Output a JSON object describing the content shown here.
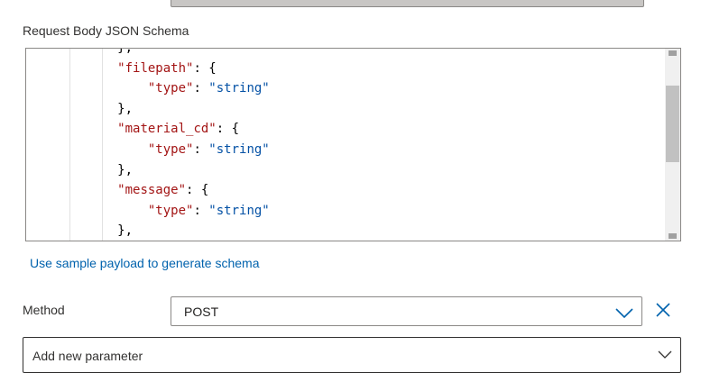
{
  "schema": {
    "label": "Request Body JSON Schema",
    "code_lines": [
      [
        {
          "t": "p",
          "v": "            },"
        }
      ],
      [
        {
          "t": "p",
          "v": "            "
        },
        {
          "t": "k",
          "v": "\"filepath\""
        },
        {
          "t": "p",
          "v": ": {"
        }
      ],
      [
        {
          "t": "p",
          "v": "                "
        },
        {
          "t": "k",
          "v": "\"type\""
        },
        {
          "t": "p",
          "v": ": "
        },
        {
          "t": "s",
          "v": "\"string\""
        }
      ],
      [
        {
          "t": "p",
          "v": "            },"
        }
      ],
      [
        {
          "t": "p",
          "v": "            "
        },
        {
          "t": "k",
          "v": "\"material_cd\""
        },
        {
          "t": "p",
          "v": ": {"
        }
      ],
      [
        {
          "t": "p",
          "v": "                "
        },
        {
          "t": "k",
          "v": "\"type\""
        },
        {
          "t": "p",
          "v": ": "
        },
        {
          "t": "s",
          "v": "\"string\""
        }
      ],
      [
        {
          "t": "p",
          "v": "            },"
        }
      ],
      [
        {
          "t": "p",
          "v": "            "
        },
        {
          "t": "k",
          "v": "\"message\""
        },
        {
          "t": "p",
          "v": ": {"
        }
      ],
      [
        {
          "t": "p",
          "v": "                "
        },
        {
          "t": "k",
          "v": "\"type\""
        },
        {
          "t": "p",
          "v": ": "
        },
        {
          "t": "s",
          "v": "\"string\""
        }
      ],
      [
        {
          "t": "p",
          "v": "            },"
        }
      ]
    ]
  },
  "sample_link": "Use sample payload to generate schema",
  "method": {
    "label": "Method",
    "value": "POST"
  },
  "add_parameter": {
    "label": "Add new parameter"
  },
  "icons": {
    "method_chevron": "chevron-down-icon",
    "remove": "close-icon",
    "add_param_chevron": "chevron-down-icon"
  },
  "colors": {
    "key": "#a31515",
    "string": "#0451a5",
    "link": "#0062ad"
  }
}
